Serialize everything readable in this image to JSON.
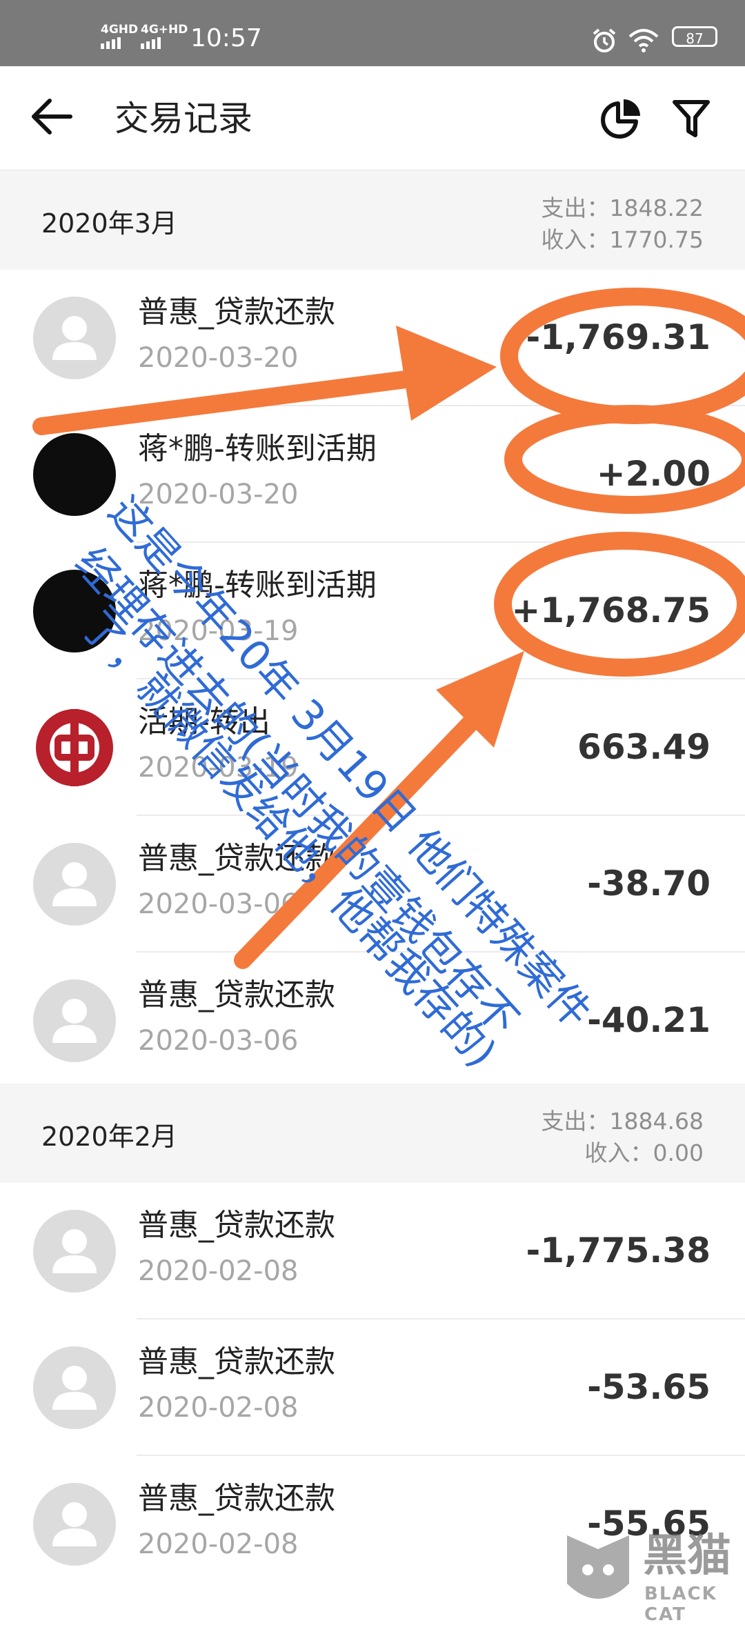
{
  "status_bar": {
    "network_1": "4GHD",
    "network_2": "4G+HD",
    "time": "10:57",
    "battery": "87"
  },
  "app_bar": {
    "title": "交易记录",
    "back_icon": "arrow-left-icon",
    "chart_icon": "pie-chart-icon",
    "filter_icon": "filter-icon"
  },
  "sections": [
    {
      "month": "2020年3月",
      "expense": "支出：1848.22",
      "income": "收入：1770.75",
      "rows": [
        {
          "name": "普惠_贷款还款",
          "date": "2020-03-20",
          "amount": "-1,769.31",
          "avatar": "default"
        },
        {
          "name": "蒋*鹏-转账到活期",
          "date": "2020-03-20",
          "amount": "+2.00",
          "avatar": "dark"
        },
        {
          "name": "蒋*鹏-转账到活期",
          "date": "2020-03-19",
          "amount": "+1,768.75",
          "avatar": "dark"
        },
        {
          "name": "活期-转出",
          "date": "2020-03-19",
          "amount": "663.49",
          "avatar": "bank"
        },
        {
          "name": "普惠_贷款还款",
          "date": "2020-03-06",
          "amount": "-38.70",
          "avatar": "default"
        },
        {
          "name": "普惠_贷款还款",
          "date": "2020-03-06",
          "amount": "-40.21",
          "avatar": "default"
        }
      ]
    },
    {
      "month": "2020年2月",
      "expense": "支出：1884.68",
      "income": "收入：0.00",
      "rows": [
        {
          "name": "普惠_贷款还款",
          "date": "2020-02-08",
          "amount": "-1,775.38",
          "avatar": "default"
        },
        {
          "name": "普惠_贷款还款",
          "date": "2020-02-08",
          "amount": "-53.65",
          "avatar": "default"
        },
        {
          "name": "普惠_贷款还款",
          "date": "2020-02-08",
          "amount": "-55.65",
          "avatar": "default"
        }
      ]
    }
  ],
  "annotation": {
    "line1": "这是今年20年 3月19日 他们特殊案件",
    "line2": "经理存进去的(当时我的壹钱包存不",
    "line3": "了，就微信发给他，他帮我存的)",
    "color": "#2f6bd6",
    "marker_color": "#f47a3c"
  },
  "watermark": {
    "text": "黑猫",
    "sub": "BLACK CAT"
  }
}
